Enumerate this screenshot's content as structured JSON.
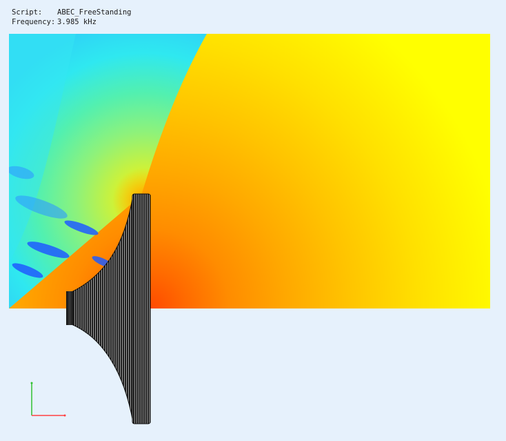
{
  "header": {
    "script_label": "Script:",
    "script_value": "ABEC_FreeStanding",
    "frequency_label": "Frequency:",
    "frequency_value": "3.985 kHz"
  },
  "colors": {
    "background": "#e6f1fc",
    "axis_x": "#ff4040",
    "axis_y": "#30c030",
    "horn_body": "#2a2a2a",
    "horn_ring": "#bfbfbf"
  },
  "field_colormap": [
    "#1f44ff",
    "#2f9cff",
    "#2fe8f0",
    "#52f5b8",
    "#8ef27a",
    "#c9f23a",
    "#ffff00",
    "#ffd000",
    "#ffa800",
    "#ff7a00",
    "#ff4a00"
  ]
}
